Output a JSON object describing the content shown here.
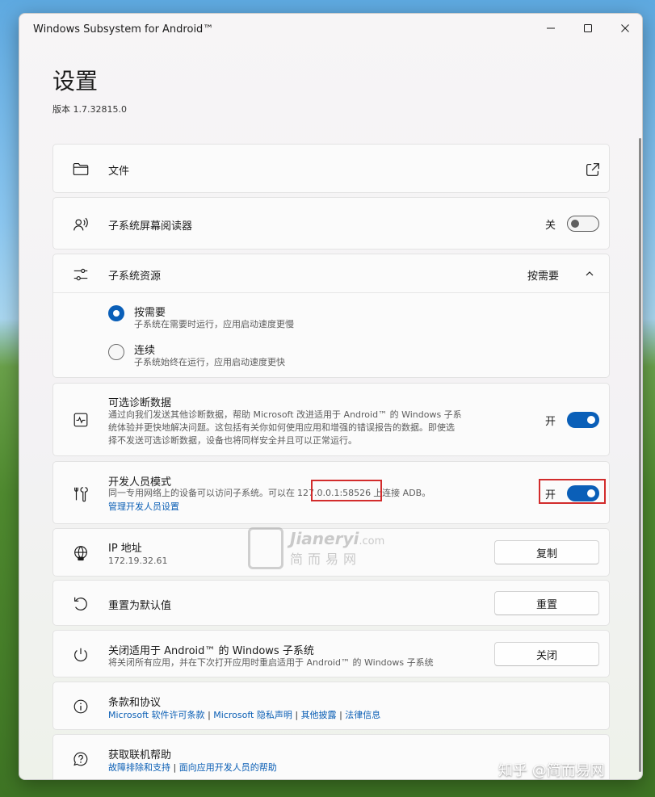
{
  "window": {
    "title": "Windows Subsystem for Android™",
    "controls": {
      "minimize_icon": "minimize-icon",
      "maximize_icon": "maximize-icon",
      "close_icon": "close-icon"
    }
  },
  "page": {
    "title": "设置",
    "version": "版本 1.7.32815.0"
  },
  "files": {
    "label": "文件",
    "icon": "folder-icon",
    "action_icon": "open-external-icon"
  },
  "screen_reader": {
    "label": "子系统屏幕阅读器",
    "state_text": "关",
    "state": "off",
    "icon": "screen-reader-icon"
  },
  "resources": {
    "label": "子系统资源",
    "selected": "按需要",
    "icon": "sliders-icon",
    "options": [
      {
        "title": "按需要",
        "desc": "子系统在需要时运行，应用启动速度更慢",
        "checked": true
      },
      {
        "title": "连续",
        "desc": "子系统始终在运行，应用启动速度更快",
        "checked": false
      }
    ]
  },
  "diagnostics": {
    "label": "可选诊断数据",
    "desc_1": "通过向我们发送其他诊断数据，帮助 Microsoft 改进适用于 Android™ 的 Windows 子系",
    "desc_2": "统体验并更快地解决问题。这包括有关你如何使用应用和增强的错误报告的数据。即使选",
    "desc_3": "择不发送可选诊断数据，设备也将同样安全并且可以正常运行。",
    "state_text": "开",
    "state": "on",
    "icon": "activity-icon"
  },
  "developer": {
    "label": "开发人员模式",
    "desc_before": "同一专用网络上的设备可以访问子系统。可以在",
    "address": "127.0.0.1:58526",
    "desc_after": "上连接 ADB。",
    "link": "管理开发人员设置",
    "state_text": "开",
    "state": "on",
    "icon": "tools-icon"
  },
  "ip": {
    "label": "IP 地址",
    "value": "172.19.32.61",
    "button": "复制",
    "icon": "globe-icon"
  },
  "reset": {
    "label": "重置为默认值",
    "button": "重置",
    "icon": "reset-icon"
  },
  "shutdown": {
    "label": "关闭适用于 Android™ 的 Windows 子系统",
    "desc": "将关闭所有应用，并在下次打开应用时重启适用于 Android™ 的 Windows 子系统",
    "button": "关闭",
    "icon": "power-icon"
  },
  "terms": {
    "label": "条款和协议",
    "links": [
      "Microsoft 软件许可条款",
      "Microsoft 隐私声明",
      "其他披露",
      "法律信息"
    ],
    "separator": "|",
    "icon": "info-icon"
  },
  "help": {
    "label": "获取联机帮助",
    "links": [
      "故障排除和支持",
      "面向应用开发人员的帮助"
    ],
    "separator": "|",
    "icon": "help-icon"
  },
  "watermark": {
    "brand": "Jianeryi",
    "domain": ".com",
    "tagline": "简而易网"
  },
  "footer_watermark": "知乎 @简而易网"
}
